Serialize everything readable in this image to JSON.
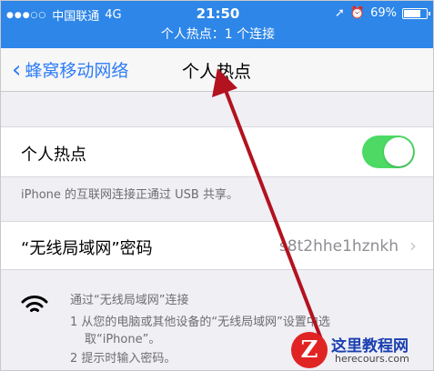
{
  "status_bar": {
    "carrier": "中国联通",
    "network": "4G",
    "time": "21:50",
    "battery_percent": "69%",
    "battery_level": 0.69,
    "hotspot_banner": "个人热点：1 个连接"
  },
  "nav": {
    "back_label": "蜂窝移动网络",
    "title": "个人热点"
  },
  "hotspot": {
    "label": "个人热点",
    "enabled": true,
    "usb_note": "iPhone 的互联网连接正通过 USB 共享。"
  },
  "password": {
    "label": "“无线局域网”密码",
    "value": "s8t2hhe1hznkh"
  },
  "instructions": {
    "heading": "通过“无线局域网”连接",
    "step1_line1": "1 从您的电脑或其他设备的“无线局域网”设置中选",
    "step1_line2": "取“iPhone”。",
    "step2": "2 提示时输入密码。"
  },
  "watermark": {
    "main": "这里教程网",
    "sub": "herecours.com"
  },
  "colors": {
    "status_bar": "#2d86e8",
    "ios_blue": "#2d7cf6",
    "toggle_on": "#4cd964",
    "arrow": "#b3121f"
  }
}
